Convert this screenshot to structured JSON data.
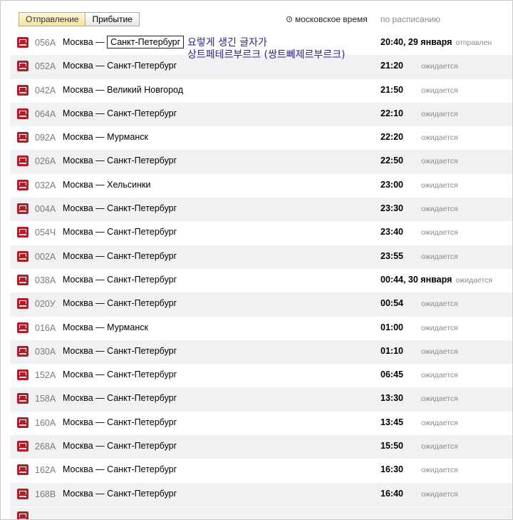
{
  "tabs": [
    {
      "label": "Отправление",
      "active": true
    },
    {
      "label": "Прибытие",
      "active": false
    }
  ],
  "timezone_label": "московское время",
  "schedule_link": "по расписанию",
  "annotation": {
    "line1": "요렇게 생긴 글자가",
    "line2": "상트페테르부르크 (쌍트뻬제르부르크)"
  },
  "icons": {
    "train": "train-icon",
    "clock": "clock-icon"
  },
  "colors": {
    "train_icon": "#b51b26",
    "active_tab": "#f4e3a4",
    "annotation": "#2b2386"
  },
  "rows": [
    {
      "number": "056A",
      "from": "Москва",
      "sep": "—",
      "to": "Санкт-Петербург",
      "time": "20:40",
      "date": ", 29 января",
      "status": "отправлен"
    },
    {
      "number": "052A",
      "from": "Москва",
      "sep": "—",
      "to": "Санкт-Петербург",
      "time": "21:20",
      "date": "",
      "status": "ожидается"
    },
    {
      "number": "042A",
      "from": "Москва",
      "sep": "—",
      "to": "Великий Новгород",
      "time": "21:50",
      "date": "",
      "status": "ожидается"
    },
    {
      "number": "064A",
      "from": "Москва",
      "sep": "—",
      "to": "Санкт-Петербург",
      "time": "22:10",
      "date": "",
      "status": "ожидается"
    },
    {
      "number": "092A",
      "from": "Москва",
      "sep": "—",
      "to": "Мурманск",
      "time": "22:20",
      "date": "",
      "status": "ожидается"
    },
    {
      "number": "026A",
      "from": "Москва",
      "sep": "—",
      "to": "Санкт-Петербург",
      "time": "22:50",
      "date": "",
      "status": "ожидается"
    },
    {
      "number": "032A",
      "from": "Москва",
      "sep": "—",
      "to": "Хельсинки",
      "time": "23:00",
      "date": "",
      "status": "ожидается"
    },
    {
      "number": "004A",
      "from": "Москва",
      "sep": "—",
      "to": "Санкт-Петербург",
      "time": "23:30",
      "date": "",
      "status": "ожидается"
    },
    {
      "number": "054Ч",
      "from": "Москва",
      "sep": "—",
      "to": "Санкт-Петербург",
      "time": "23:40",
      "date": "",
      "status": "ожидается"
    },
    {
      "number": "002A",
      "from": "Москва",
      "sep": "—",
      "to": "Санкт-Петербург",
      "time": "23:55",
      "date": "",
      "status": "ожидается"
    },
    {
      "number": "038A",
      "from": "Москва",
      "sep": "—",
      "to": "Санкт-Петербург",
      "time": "00:44",
      "date": ", 30 января",
      "status": "ожидается"
    },
    {
      "number": "020У",
      "from": "Москва",
      "sep": "—",
      "to": "Санкт-Петербург",
      "time": "00:54",
      "date": "",
      "status": "ожидается"
    },
    {
      "number": "016A",
      "from": "Москва",
      "sep": "—",
      "to": "Мурманск",
      "time": "01:00",
      "date": "",
      "status": "ожидается"
    },
    {
      "number": "030A",
      "from": "Москва",
      "sep": "—",
      "to": "Санкт-Петербург",
      "time": "01:10",
      "date": "",
      "status": "ожидается"
    },
    {
      "number": "152A",
      "from": "Москва",
      "sep": "—",
      "to": "Санкт-Петербург",
      "time": "06:45",
      "date": "",
      "status": "ожидается"
    },
    {
      "number": "158A",
      "from": "Москва",
      "sep": "—",
      "to": "Санкт-Петербург",
      "time": "13:30",
      "date": "",
      "status": "ожидается"
    },
    {
      "number": "160A",
      "from": "Москва",
      "sep": "—",
      "to": "Санкт-Петербург",
      "time": "13:45",
      "date": "",
      "status": "ожидается"
    },
    {
      "number": "268A",
      "from": "Москва",
      "sep": "—",
      "to": "Санкт-Петербург",
      "time": "15:50",
      "date": "",
      "status": "ожидается"
    },
    {
      "number": "162A",
      "from": "Москва",
      "sep": "—",
      "to": "Санкт-Петербург",
      "time": "16:30",
      "date": "",
      "status": "ожидается"
    },
    {
      "number": "168B",
      "from": "Москва",
      "sep": "—",
      "to": "Санкт-Петербург",
      "time": "16:40",
      "date": "",
      "status": "ожидается"
    }
  ]
}
